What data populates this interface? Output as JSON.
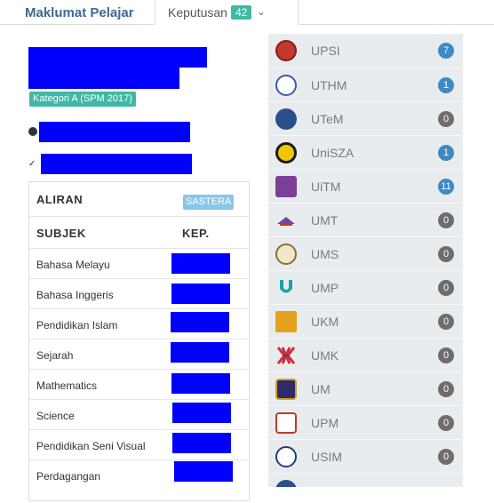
{
  "tabs": [
    {
      "label": "Maklumat Pelajar",
      "active": false
    },
    {
      "label": "Keputusan",
      "badge": "42",
      "active": true
    }
  ],
  "profile": {
    "category_badge": "Kategori A (SPM 2017)"
  },
  "stream_table": {
    "stream_label": "ALIRAN",
    "stream_value": "SASTERA",
    "subject_header": "SUBJEK",
    "grade_header": "KEP.",
    "subjects": [
      "Bahasa Melayu",
      "Bahasa Inggeris",
      "Pendidikan Islam",
      "Sejarah",
      "Mathematics",
      "Science",
      "Pendidikan Seni Visual",
      "Perdagangan"
    ]
  },
  "universities": [
    {
      "name": "UPSI",
      "count": "7",
      "color": "#3e8ac5",
      "logo": "upsi-logo-icon"
    },
    {
      "name": "UTHM",
      "count": "1",
      "color": "#3e8ac5",
      "logo": "uthm-logo-icon"
    },
    {
      "name": "UTeM",
      "count": "0",
      "color": "#6d6d6d",
      "logo": "utem-logo-icon"
    },
    {
      "name": "UniSZA",
      "count": "1",
      "color": "#3e8ac5",
      "logo": "unisza-logo-icon"
    },
    {
      "name": "UiTM",
      "count": "11",
      "color": "#3e8ac5",
      "logo": "uitm-logo-icon"
    },
    {
      "name": "UMT",
      "count": "0",
      "color": "#6d6d6d",
      "logo": "umt-logo-icon"
    },
    {
      "name": "UMS",
      "count": "0",
      "color": "#6d6d6d",
      "logo": "ums-logo-icon"
    },
    {
      "name": "UMP",
      "count": "0",
      "color": "#6d6d6d",
      "logo": "ump-logo-icon"
    },
    {
      "name": "UKM",
      "count": "0",
      "color": "#6d6d6d",
      "logo": "ukm-logo-icon"
    },
    {
      "name": "UMK",
      "count": "0",
      "color": "#6d6d6d",
      "logo": "umk-logo-icon"
    },
    {
      "name": "UM",
      "count": "0",
      "color": "#6d6d6d",
      "logo": "um-logo-icon"
    },
    {
      "name": "UPM",
      "count": "0",
      "color": "#6d6d6d",
      "logo": "upm-logo-icon"
    },
    {
      "name": "USIM",
      "count": "0",
      "color": "#6d6d6d",
      "logo": "usim-logo-icon"
    }
  ],
  "colors": {
    "accent_teal": "#3fb8a5",
    "badge_blue": "#3e8ac5",
    "badge_gray": "#6d6d6d",
    "redaction": "#0000ff",
    "list_bg": "#e9ecef"
  }
}
